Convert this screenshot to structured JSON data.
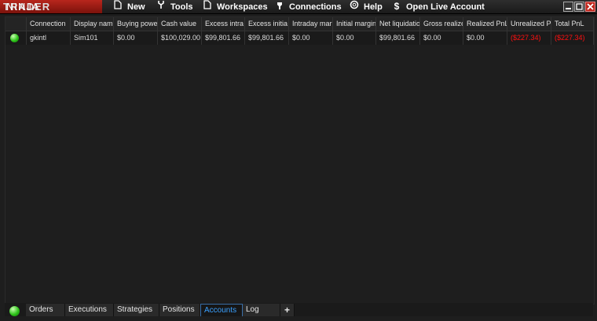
{
  "app": {
    "logo_left": "NINJA",
    "logo_right": "TRADER"
  },
  "menu": [
    {
      "label": "New",
      "icon": "new-document-icon"
    },
    {
      "label": "Tools",
      "icon": "tools-icon"
    },
    {
      "label": "Workspaces",
      "icon": "workspace-icon"
    },
    {
      "label": "Connections",
      "icon": "plug-icon"
    },
    {
      "label": "Help",
      "icon": "lifebuoy-icon"
    },
    {
      "label": "Open Live Account",
      "icon": "dollar-icon"
    }
  ],
  "table": {
    "headers": [
      "Connection",
      "Display nam",
      "Buying powe",
      "Cash value",
      "Excess intra",
      "Excess initia",
      "Intraday mar",
      "Initial margin",
      "Net liquidatio",
      "Gross realize",
      "Realized PnL",
      "Unrealized P",
      "Total PnL"
    ],
    "rows": [
      {
        "status": "connected",
        "cells": [
          "gkintl",
          "Sim101",
          "$0.00",
          "$100,029.00",
          "$99,801.66",
          "$99,801.66",
          "$0.00",
          "$0.00",
          "$99,801.66",
          "$0.00",
          "$0.00",
          "($227.34)",
          "($227.34)"
        ]
      }
    ]
  },
  "tabs": {
    "items": [
      "Orders",
      "Executions",
      "Strategies",
      "Positions",
      "Accounts",
      "Log",
      "+"
    ],
    "active": "Accounts"
  },
  "colors": {
    "negative": "#ff1010",
    "active_tab": "#3aa0ff",
    "logo_bg": "#b8261d",
    "status_green": "#2ec41a"
  }
}
